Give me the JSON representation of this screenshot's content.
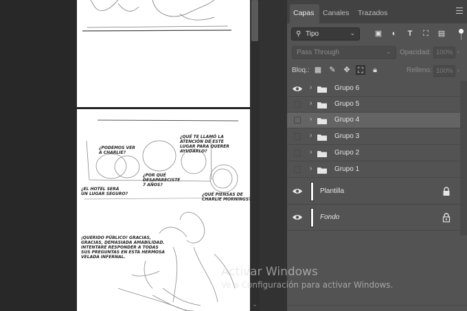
{
  "panel": {
    "tabs": [
      {
        "label": "Capas",
        "active": true
      },
      {
        "label": "Canales",
        "active": false
      },
      {
        "label": "Trazados",
        "active": false
      }
    ],
    "filter": {
      "kind_label": "Tipo",
      "icons": [
        "image-filter-icon",
        "adjustment-filter-icon",
        "type-filter-icon",
        "shape-filter-icon",
        "smart-object-filter-icon"
      ]
    },
    "blend_mode": "Pass Through",
    "opacity_label": "Opacidad:",
    "opacity_value": "100%",
    "lock_label": "Bloq.:",
    "fill_label": "Relleno:",
    "fill_value": "100%"
  },
  "layers": [
    {
      "name": "Grupo 6",
      "visible": true,
      "type": "group"
    },
    {
      "name": "Grupo 5",
      "visible": false,
      "type": "group"
    },
    {
      "name": "Grupo 4",
      "visible": false,
      "type": "group",
      "selected": true
    },
    {
      "name": "Grupo 3",
      "visible": false,
      "type": "group"
    },
    {
      "name": "Grupo 2",
      "visible": false,
      "type": "group"
    },
    {
      "name": "Grupo 1",
      "visible": false,
      "type": "group"
    },
    {
      "name": "Plantilla",
      "visible": true,
      "type": "layer",
      "locked": true
    },
    {
      "name": "Fondo",
      "visible": true,
      "type": "background",
      "locked": true
    }
  ],
  "comic": {
    "bubble1": "¿PODEMOS VER\nA CHARLIE?",
    "bubble2": "¿QUÉ TE LLAMÓ LA\nATENCIÓN DE ESTE\nLUGAR PARA QUERER\nAYUDARLO?",
    "bubble3": "¿POR QUÉ\nDESAPARECISTE\n7 AÑOS?",
    "bubble4": "¿EL HOTEL SERÁ\nUN LUGAR SEGURO?",
    "bubble5": "¿QUÉ PIENSAS DE\nCHARLIE MORNINGSTAR?",
    "bubble6": "¡QUERIDO PÚBLICO! GRACIAS,\nGRACIAS, DEMASIADA AMABILIDAD.\nINTENTARÉ RESPONDER A TODAS\nSUS PREGUNTAS EN ESTA HERMOSA\nVELADA INFERNAL."
  },
  "watermark": {
    "title": "Activar Windows",
    "subtitle": "Ve a Configuración para activar Windows."
  }
}
